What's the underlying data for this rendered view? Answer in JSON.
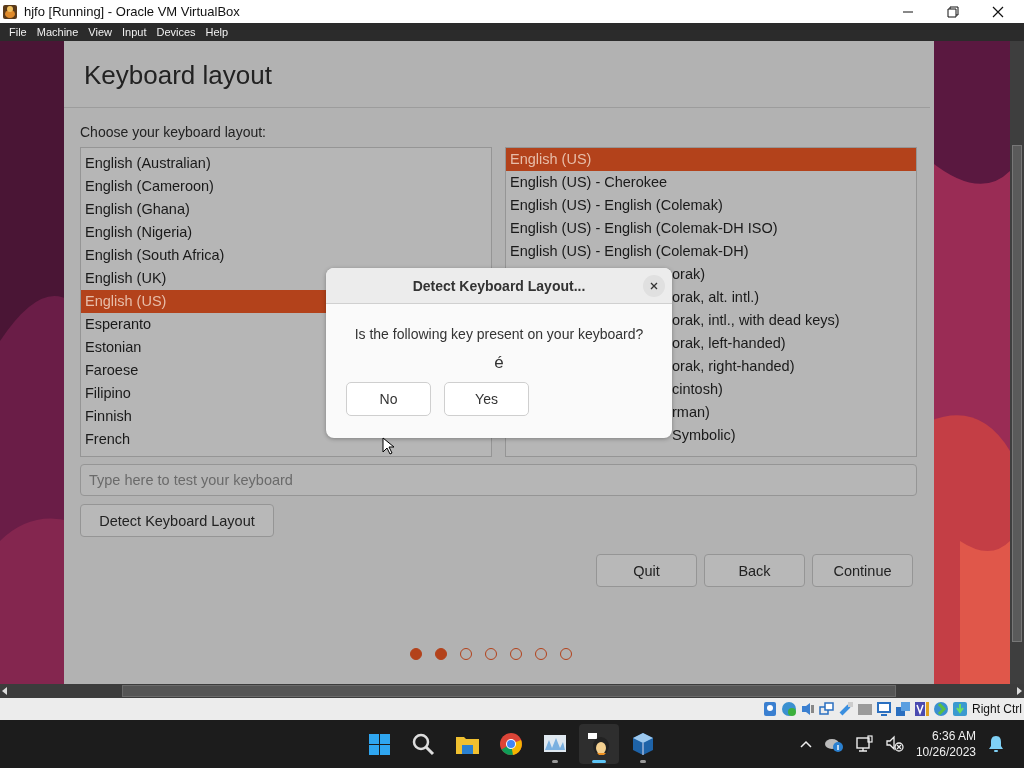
{
  "window": {
    "title": "hjfo [Running] - Oracle VM VirtualBox"
  },
  "menu_bar": [
    "File",
    "Machine",
    "View",
    "Input",
    "Devices",
    "Help"
  ],
  "installer": {
    "heading": "Keyboard layout",
    "prompt": "Choose your keyboard layout:",
    "layouts": [
      {
        "label": "English (Australian)",
        "selected": false
      },
      {
        "label": "English (Cameroon)",
        "selected": false
      },
      {
        "label": "English (Ghana)",
        "selected": false
      },
      {
        "label": "English (Nigeria)",
        "selected": false
      },
      {
        "label": "English (South Africa)",
        "selected": false
      },
      {
        "label": "English (UK)",
        "selected": false
      },
      {
        "label": "English (US)",
        "selected": true
      },
      {
        "label": "Esperanto",
        "selected": false
      },
      {
        "label": "Estonian",
        "selected": false
      },
      {
        "label": "Faroese",
        "selected": false
      },
      {
        "label": "Filipino",
        "selected": false
      },
      {
        "label": "Finnish",
        "selected": false
      },
      {
        "label": "French",
        "selected": false
      }
    ],
    "variants": [
      {
        "label": "English (US)",
        "selected": true,
        "covered": false
      },
      {
        "label": "English (US) - Cherokee",
        "selected": false,
        "covered": false
      },
      {
        "label": "English (US) - English (Colemak)",
        "selected": false,
        "covered": false
      },
      {
        "label": "English (US) - English (Colemak-DH ISO)",
        "selected": false,
        "covered": false
      },
      {
        "label": "English (US) - English (Colemak-DH)",
        "selected": false,
        "covered": false
      },
      {
        "label": "orak)",
        "selected": false,
        "covered": true
      },
      {
        "label": "orak, alt. intl.)",
        "selected": false,
        "covered": true
      },
      {
        "label": "orak, intl., with dead keys)",
        "selected": false,
        "covered": true
      },
      {
        "label": "orak, left-handed)",
        "selected": false,
        "covered": true
      },
      {
        "label": "orak, right-handed)",
        "selected": false,
        "covered": true
      },
      {
        "label": "cintosh)",
        "selected": false,
        "covered": true
      },
      {
        "label": "rman)",
        "selected": false,
        "covered": true
      },
      {
        "label": "Symbolic)",
        "selected": false,
        "covered": true
      }
    ],
    "test_field": {
      "placeholder": "Type here to test your keyboard"
    },
    "detect_button": "Detect Keyboard Layout",
    "nav_buttons": [
      "Quit",
      "Back",
      "Continue"
    ],
    "steps": [
      {
        "filled": true
      },
      {
        "filled": true
      },
      {
        "filled": false
      },
      {
        "filled": false
      },
      {
        "filled": false
      },
      {
        "filled": false
      },
      {
        "filled": false
      }
    ]
  },
  "dialog": {
    "title": "Detect Keyboard Layout...",
    "question": "Is the following key present on your keyboard?",
    "key": "é",
    "buttons": [
      "No",
      "Yes"
    ]
  },
  "status_bar": {
    "host_key": "Right Ctrl"
  },
  "taskbar": {
    "apps": [
      {
        "kind": "start",
        "running": false,
        "active": false
      },
      {
        "kind": "search",
        "running": false,
        "active": false
      },
      {
        "kind": "files",
        "running": false,
        "active": false
      },
      {
        "kind": "browser",
        "running": false,
        "active": false
      },
      {
        "kind": "monitor",
        "running": true,
        "active": false
      },
      {
        "kind": "penguin",
        "running": true,
        "active": true
      },
      {
        "kind": "cube",
        "running": true,
        "active": false
      }
    ],
    "time": "6:36 AM",
    "date": "10/26/2023"
  }
}
